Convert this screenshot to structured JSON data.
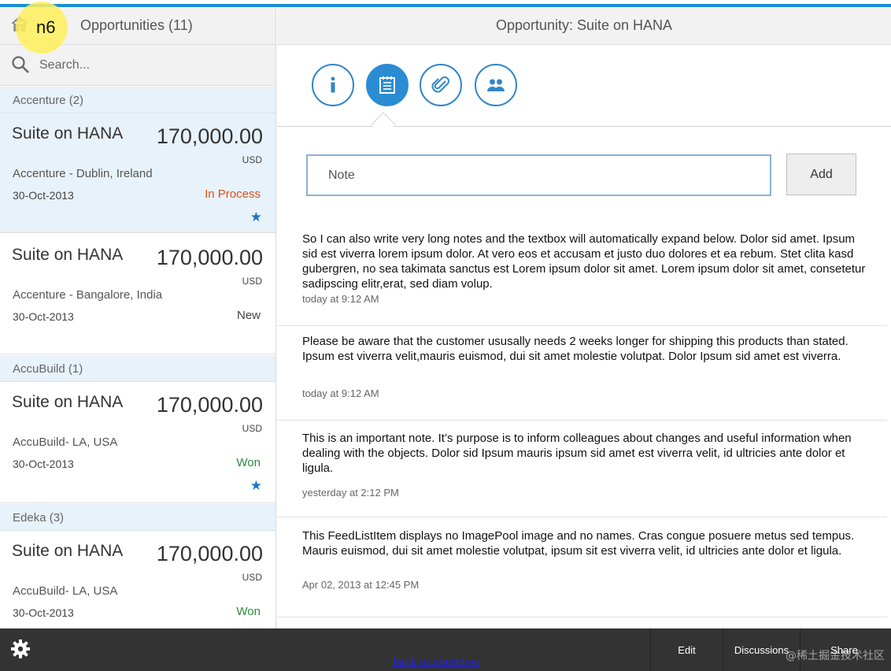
{
  "overlay_badge": "n6",
  "master": {
    "title": "Opportunities (11)",
    "search_placeholder": "Search...",
    "groups": [
      {
        "label": "Accenture (2)",
        "items": [
          {
            "title": "Suite on HANA",
            "amount": "170,000.00",
            "currency": "USD",
            "location": "Accenture - Dublin, Ireland",
            "date": "30-Oct-2013",
            "status": "In Process",
            "status_color": "#d9501a",
            "starred": true,
            "selected": true
          },
          {
            "title": "Suite on HANA",
            "amount": "170,000.00",
            "currency": "USD",
            "location": "Accenture - Bangalore, India",
            "date": "30-Oct-2013",
            "status": "New",
            "status_color": "#444444",
            "starred": false,
            "selected": false
          }
        ]
      },
      {
        "label": "AccuBuild (1)",
        "items": [
          {
            "title": "Suite on HANA",
            "amount": "170,000.00",
            "currency": "USD",
            "location": "AccuBuild- LA, USA",
            "date": "30-Oct-2013",
            "status": "Won",
            "status_color": "#2b8a3a",
            "starred": true,
            "selected": false
          }
        ]
      },
      {
        "label": "Edeka (3)",
        "items": [
          {
            "title": "Suite on HANA",
            "amount": "170,000.00",
            "currency": "USD",
            "location": "AccuBuild- LA, USA",
            "date": "30-Oct-2013",
            "status": "Won",
            "status_color": "#2b8a3a",
            "starred": false,
            "selected": false
          }
        ]
      }
    ]
  },
  "detail": {
    "title": "Opportunity: Suite on HANA",
    "tabs": [
      {
        "icon": "info-icon",
        "active": false
      },
      {
        "icon": "notes-icon",
        "active": true
      },
      {
        "icon": "attachment-icon",
        "active": false
      },
      {
        "icon": "contacts-icon",
        "active": false
      }
    ],
    "note_placeholder": "Note",
    "add_label": "Add",
    "feed": [
      {
        "text": "So I can also write very long notes and the textbox will automatically expand below. Dolor sid amet. Ipsum sid est viverra lorem ipsum dolor. At vero eos et accusam et justo duo dolores et ea rebum. Stet clita kasd gubergren, no sea takimata sanctus est Lorem ipsum dolor sit amet. Lorem ipsum dolor sit amet, consetetur sadipscing elitr,erat, sed diam volup.",
        "time": "today at 9:12 AM"
      },
      {
        "text": "Please be aware that the customer ususally needs 2 weeks longer for shipping this products than stated. Ipsum est viverra velit,mauris euismod, dui sit amet molestie volutpat. Dolor Ipsum sid amet est viverra.",
        "time": "today at 9:12 AM"
      },
      {
        "text": "This is an important note. It’s purpose is to inform colleagues about changes and useful information when dealing with the objects. Dolor sid Ipsum mauris ipsum sid amet est viverra velit, id ultricies ante dolor et ligula.",
        "time": "yesterday at 2:12 PM"
      },
      {
        "text": "This FeedListItem displays no ImagePool image and no names. Cras congue posuere metus sed tempus. Mauris euismod, dui sit amet molestie volutpat, ipsum sit est viverra velit, id ultricies ante dolor et ligula.",
        "time": "Apr 02, 2013 at 12:45 PM"
      }
    ]
  },
  "footer": {
    "edit_label": "Edit",
    "discussions_label": "Discussions",
    "share_label": "Share",
    "back_link": "back to overview",
    "watermark": "@稀土掘金技术社区"
  }
}
